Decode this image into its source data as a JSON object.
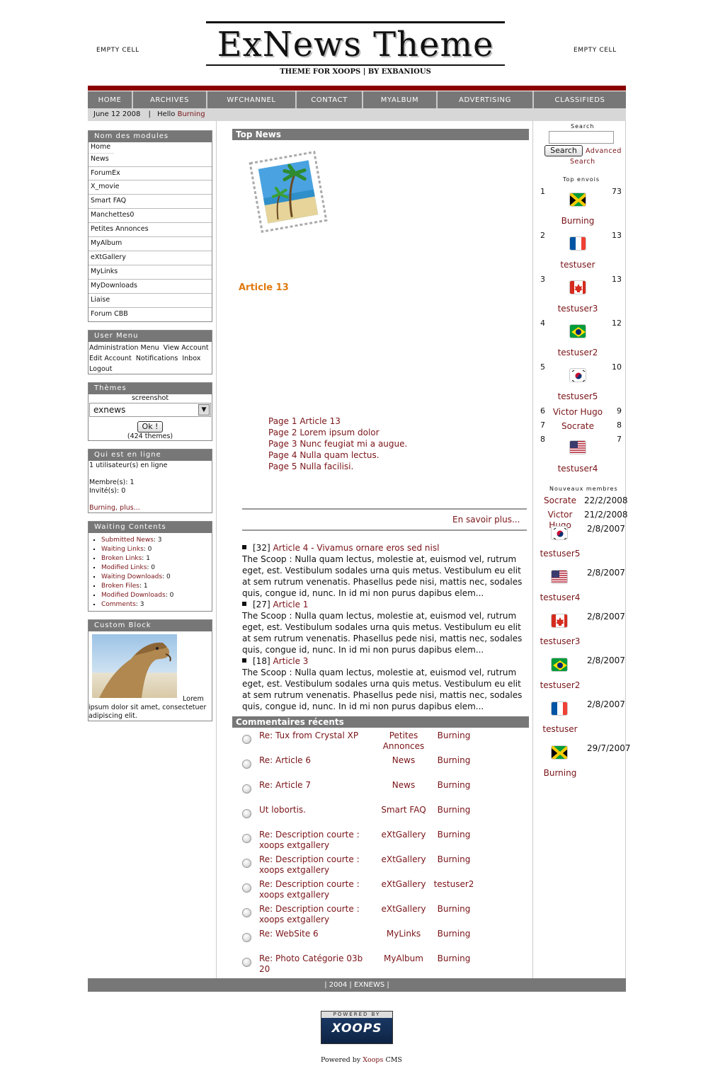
{
  "header": {
    "empty_left": "EMPTY CELL",
    "empty_right": "EMPTY CELL",
    "logo_title": "ExNews Theme",
    "logo_subtitle": "THEME FOR XOOPS | BY EXBANIOUS"
  },
  "nav": [
    "HOME",
    "ARCHIVES",
    "WFCHANNEL",
    "CONTACT",
    "MYALBUM",
    "ADVERTISING",
    "CLASSIFIEDS"
  ],
  "datebar": {
    "date": "June 12 2008",
    "hello": "Hello",
    "user": "Burning"
  },
  "modules": {
    "title": "Nom des modules",
    "items": [
      "Home",
      "News",
      "ForumEx",
      "X_movie",
      "Smart FAQ",
      "Manchettes0",
      "Petites Annonces",
      "MyAlbum",
      "eXtGallery",
      "MyLinks",
      "MyDownloads",
      "Liaise",
      "Forum CBB"
    ]
  },
  "user_menu": {
    "title": "User Menu",
    "items": [
      "Administration Menu",
      "View Account",
      "Edit Account",
      "Notifications",
      "Inbox",
      "Logout"
    ]
  },
  "themes": {
    "title": "Thèmes",
    "screenshot_label": "screenshot",
    "selected": "exnews",
    "ok_label": "Ok !",
    "count": "(424 themes)"
  },
  "online": {
    "title": "Qui est en ligne",
    "line1": "1 utilisateur(s) en ligne",
    "members": "Membre(s): 1",
    "guests": "Invité(s): 0",
    "user": "Burning",
    "more": "plus..."
  },
  "waiting": {
    "title": "Waiting Contents",
    "items": [
      {
        "label": "Submitted News",
        "value": "3"
      },
      {
        "label": "Waiting Links",
        "value": "0"
      },
      {
        "label": "Broken Links",
        "value": "1"
      },
      {
        "label": "Modified Links",
        "value": "0"
      },
      {
        "label": "Waiting Downloads",
        "value": "0"
      },
      {
        "label": "Broken Files",
        "value": "1"
      },
      {
        "label": "Modified Downloads",
        "value": "0"
      },
      {
        "label": "Comments",
        "value": "3"
      }
    ]
  },
  "custom": {
    "title": "Custom Block",
    "text_a": "Lorem",
    "text_b": "ipsum dolor sit amet, consectetuer adipiscing elit."
  },
  "top_news": {
    "title": "Top News",
    "article": "Article 13",
    "pages": [
      "Page 1 Article 13",
      "Page 2 Lorem ipsum dolor",
      "Page 3 Nunc feugiat mi a augue.",
      "Page 4 Nulla quam lectus.",
      "Page 5 Nulla facilisi."
    ],
    "more": "En savoir plus..."
  },
  "news_list": [
    {
      "id": "[32]",
      "title": "Article 4 - Vivamus ornare eros sed nisl",
      "scoop": "The Scoop : Nulla quam lectus, molestie at, euismod vel, rutrum eget, est. Vestibulum sodales urna quis metus. Vestibulum eu elit at sem rutrum venenatis. Phasellus pede nisi, mattis nec, sodales quis, congue id, nunc. In id mi non purus dapibus elem..."
    },
    {
      "id": "[27]",
      "title": "Article 1",
      "scoop": "The Scoop : Nulla quam lectus, molestie at, euismod vel, rutrum eget, est. Vestibulum sodales urna quis metus. Vestibulum eu elit at sem rutrum venenatis. Phasellus pede nisi, mattis nec, sodales quis, congue id, nunc. In id mi non purus dapibus elem..."
    },
    {
      "id": "[18]",
      "title": "Article 3",
      "scoop": "The Scoop : Nulla quam lectus, molestie at, euismod vel, rutrum eget, est. Vestibulum sodales urna quis metus. Vestibulum eu elit at sem rutrum venenatis. Phasellus pede nisi, mattis nec, sodales quis, congue id, nunc. In id mi non purus dapibus elem..."
    }
  ],
  "comments": {
    "title": "Commentaires récents",
    "rows": [
      {
        "title": "Re: Tux from Crystal XP",
        "module": "Petites Annonces",
        "user": "Burning"
      },
      {
        "title": "Re: Article 6",
        "module": "News",
        "user": "Burning"
      },
      {
        "title": "Re: Article 7",
        "module": "News",
        "user": "Burning"
      },
      {
        "title": "Ut lobortis.",
        "module": "Smart FAQ",
        "user": "Burning"
      },
      {
        "title": "Re: Description courte : xoops extgallery",
        "module": "eXtGallery",
        "user": "Burning"
      },
      {
        "title": "Re: Description courte : xoops extgallery",
        "module": "eXtGallery",
        "user": "Burning"
      },
      {
        "title": "Re: Description courte : xoops extgallery",
        "module": "eXtGallery",
        "user": "testuser2"
      },
      {
        "title": "Re: Description courte : xoops extgallery",
        "module": "eXtGallery",
        "user": "Burning"
      },
      {
        "title": "Re: WebSite 6",
        "module": "MyLinks",
        "user": "Burning"
      },
      {
        "title": "Re: Photo Catégorie 03b 20",
        "module": "MyAlbum",
        "user": "Burning"
      }
    ]
  },
  "search": {
    "label": "Search",
    "button": "Search",
    "advanced1": "Advanced",
    "advanced2": "Search"
  },
  "top_posters": {
    "title": "Top envois",
    "rows": [
      {
        "rank": "1",
        "user": "Burning",
        "count": "73",
        "flag": "jamaica"
      },
      {
        "rank": "2",
        "user": "testuser",
        "count": "13",
        "flag": "france"
      },
      {
        "rank": "3",
        "user": "testuser3",
        "count": "13",
        "flag": "canada"
      },
      {
        "rank": "4",
        "user": "testuser2",
        "count": "12",
        "flag": "brazil"
      },
      {
        "rank": "5",
        "user": "testuser5",
        "count": "10",
        "flag": "korea"
      },
      {
        "rank": "6",
        "user": "Victor Hugo",
        "count": "9",
        "flag": ""
      },
      {
        "rank": "7",
        "user": "Socrate",
        "count": "8",
        "flag": ""
      },
      {
        "rank": "8",
        "user": "testuser4",
        "count": "7",
        "flag": "usa"
      }
    ]
  },
  "new_members": {
    "title": "Nouveaux membres",
    "rows": [
      {
        "user": "Socrate",
        "date": "22/2/2008",
        "flag": ""
      },
      {
        "user": "Victor Hugo",
        "date": "21/2/2008",
        "flag": ""
      },
      {
        "user": "testuser5",
        "date": "2/8/2007",
        "flag": "korea"
      },
      {
        "user": "testuser4",
        "date": "2/8/2007",
        "flag": "usa"
      },
      {
        "user": "testuser3",
        "date": "2/8/2007",
        "flag": "canada"
      },
      {
        "user": "testuser2",
        "date": "2/8/2007",
        "flag": "brazil"
      },
      {
        "user": "testuser",
        "date": "2/8/2007",
        "flag": "france"
      },
      {
        "user": "Burning",
        "date": "29/7/2007",
        "flag": "jamaica"
      }
    ]
  },
  "footer": {
    "text": "| 2004 | EXNEWS |",
    "badge_top": "POWERED BY",
    "badge_word": "XOOPS",
    "powered": "Powered by",
    "powered_link": "Xoops",
    "cms": "CMS"
  }
}
